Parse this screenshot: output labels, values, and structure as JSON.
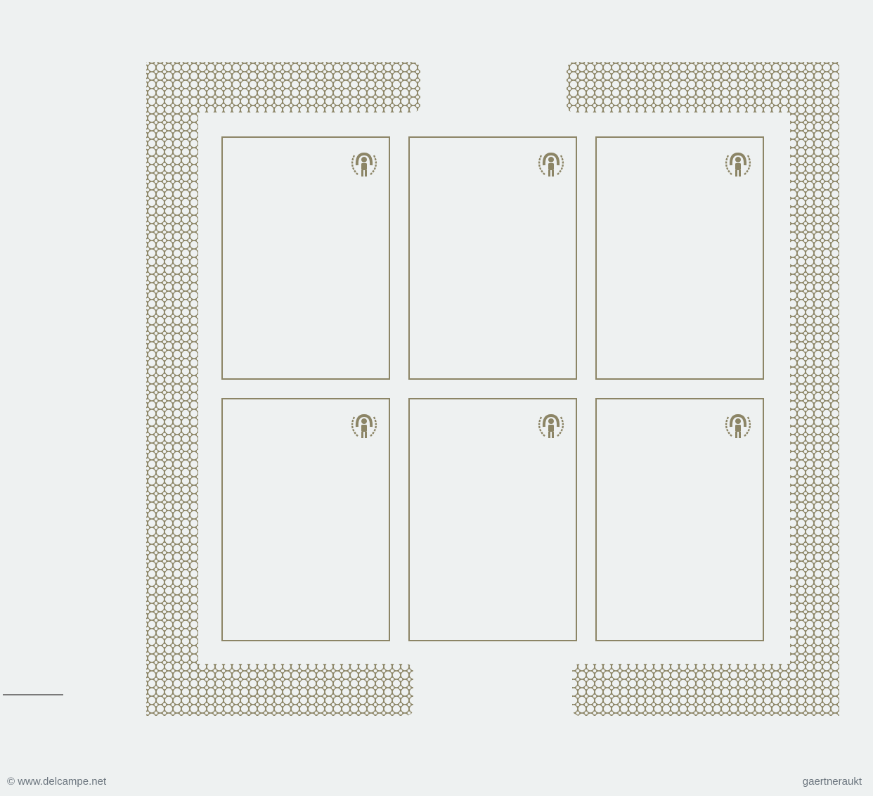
{
  "sheet": {
    "ink_color": "#8c8566",
    "paper_color": "#eef1f1",
    "stamp_frames": [
      {
        "row": 1,
        "col": 1,
        "logo": "iyc-child-emblem-icon"
      },
      {
        "row": 1,
        "col": 2,
        "logo": "iyc-child-emblem-icon"
      },
      {
        "row": 1,
        "col": 3,
        "logo": "iyc-child-emblem-icon"
      },
      {
        "row": 2,
        "col": 1,
        "logo": "iyc-child-emblem-icon"
      },
      {
        "row": 2,
        "col": 2,
        "logo": "iyc-child-emblem-icon"
      },
      {
        "row": 2,
        "col": 3,
        "logo": "iyc-child-emblem-icon"
      }
    ]
  },
  "watermarks": {
    "left": "© www.delcampe.net",
    "right": "gaertneraukt"
  }
}
